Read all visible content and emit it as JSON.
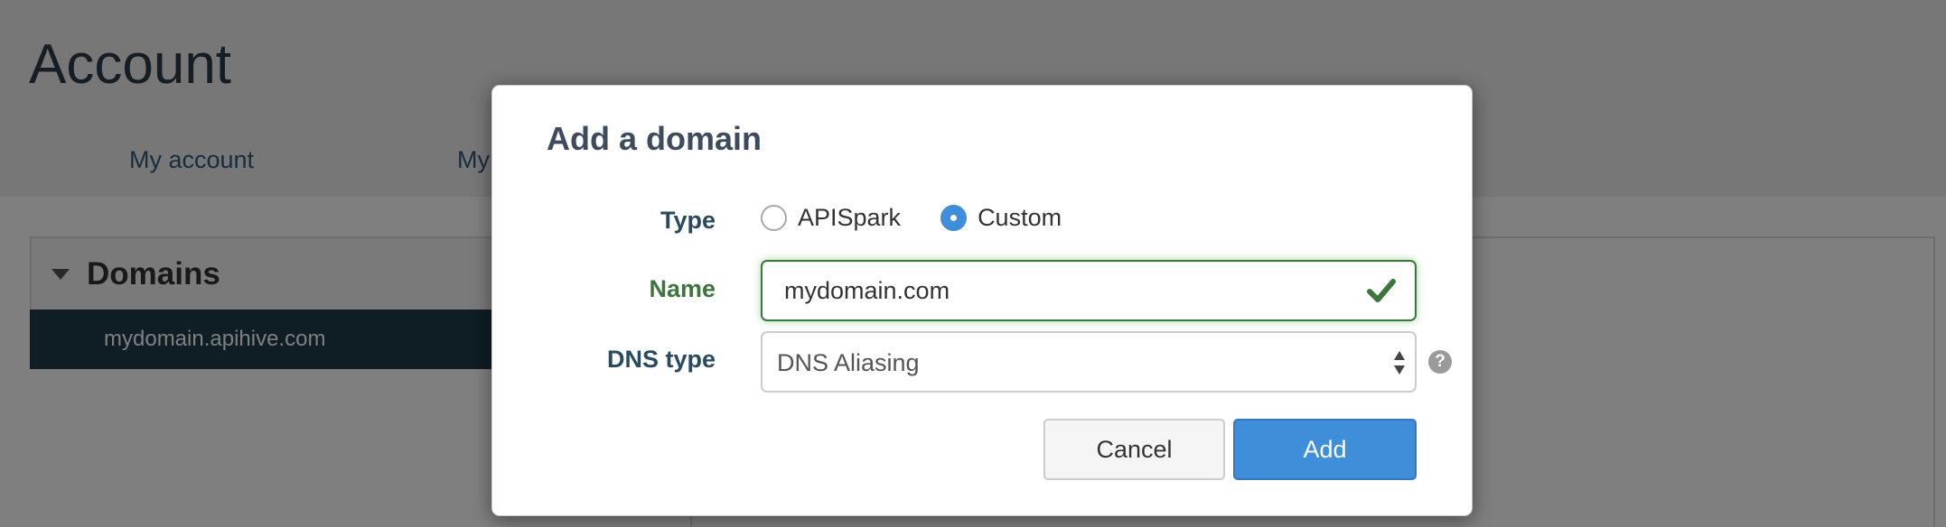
{
  "page": {
    "title": "Account",
    "tabs": [
      "My account",
      "My"
    ]
  },
  "domains": {
    "title": "Domains",
    "items": [
      "mydomain.apihive.com"
    ]
  },
  "modal": {
    "title": "Add a domain",
    "type_label": "Type",
    "type_options": [
      "APISpark",
      "Custom"
    ],
    "type_selected": "Custom",
    "name_label": "Name",
    "name_value": "mydomain.com",
    "dns_label": "DNS type",
    "dns_value": "DNS Aliasing",
    "help_glyph": "?",
    "cancel_label": "Cancel",
    "add_label": "Add"
  },
  "icons": {
    "domains_toggle": "caret-down-icon",
    "name_valid": "checkmark-icon",
    "dns_dropdown": "up-down-arrows-icon",
    "dns_help": "question-circle-icon"
  },
  "colors": {
    "primary": "#3e8ed9",
    "success": "#3c763d",
    "selected_row": "#1f3a4a",
    "overlay": "rgba(0,0,0,0.5)"
  }
}
